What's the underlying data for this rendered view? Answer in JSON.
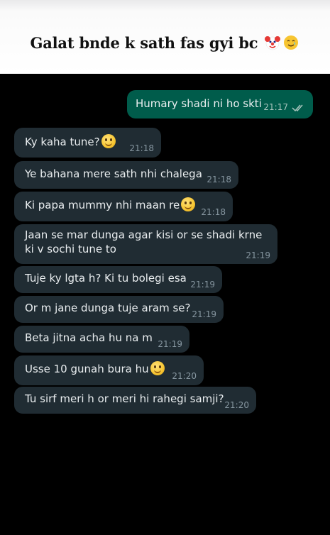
{
  "caption": {
    "text": "Galat bnde k sath fas gyi bc"
  },
  "caption_emojis": [
    "clown-face",
    "smiling-face-with-tear"
  ],
  "colors": {
    "incoming_bubble": "#202c33",
    "outgoing_bubble": "#005c4b",
    "background": "#000000",
    "read_ticks": "#a8c5bd"
  },
  "messages": [
    {
      "dir": "out",
      "text": "Humary shadi ni ho skti",
      "time": "21:17",
      "status": "read"
    },
    {
      "dir": "in",
      "text": "Ky kaha tune?",
      "emoji": "slightly-smiling-face",
      "time": "21:18"
    },
    {
      "dir": "in",
      "text": "Ye bahana mere sath nhi chalega",
      "time": "21:18"
    },
    {
      "dir": "in",
      "text": "Ki papa mummy nhi maan re",
      "emoji": "slightly-smiling-face",
      "time": "21:18"
    },
    {
      "dir": "in",
      "text": "Jaan se mar dunga agar kisi or se shadi krne ki v sochi tune to",
      "time": "21:19"
    },
    {
      "dir": "in",
      "text": "Tuje ky lgta h? Ki tu bolegi esa",
      "time": "21:19"
    },
    {
      "dir": "in",
      "text": "Or m jane dunga tuje aram se?",
      "time": "21:19"
    },
    {
      "dir": "in",
      "text": "Beta jitna acha hu na m",
      "time": "21:19"
    },
    {
      "dir": "in",
      "text": "Usse 10 gunah bura hu",
      "emoji": "slightly-smiling-face",
      "time": "21:20"
    },
    {
      "dir": "in",
      "text": "Tu sirf meri h or meri hi rahegi samji?",
      "time": "21:20"
    }
  ]
}
